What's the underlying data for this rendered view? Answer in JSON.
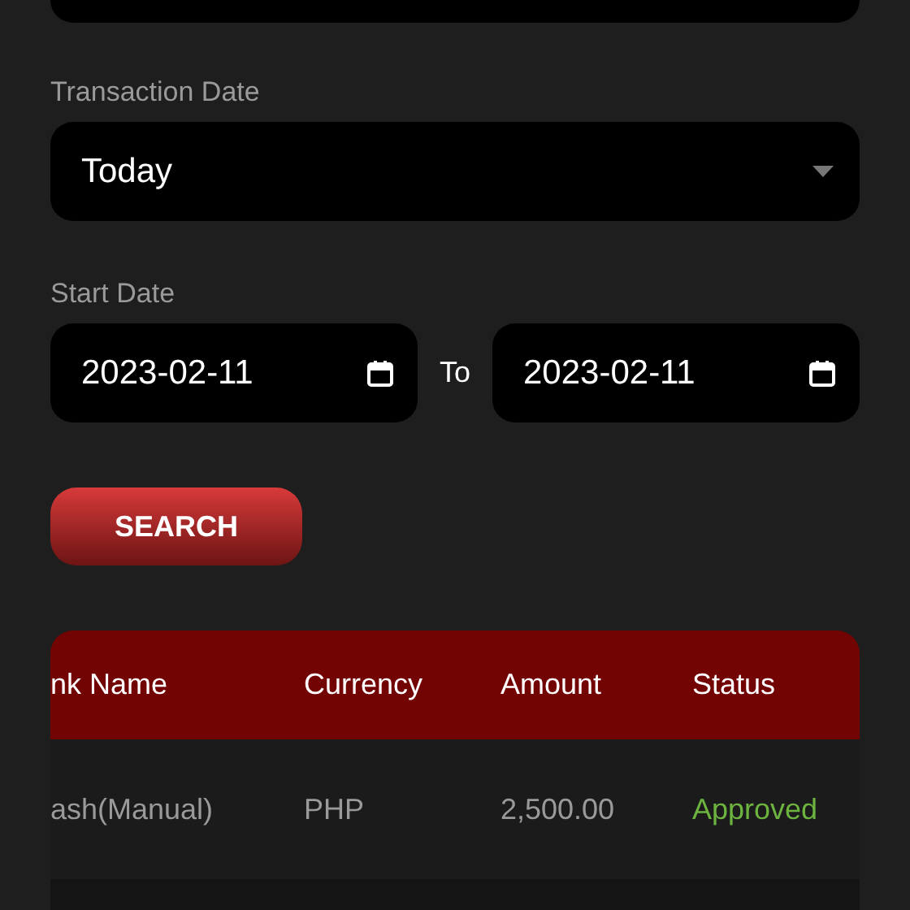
{
  "transaction_date": {
    "label": "Transaction Date",
    "value": "Today"
  },
  "date_range": {
    "label": "Start Date",
    "start": "2023-02-11",
    "separator": "To",
    "end": "2023-02-11"
  },
  "search_button": {
    "label": "SEARCH"
  },
  "table": {
    "columns": [
      "nk Name",
      "Currency",
      "Amount",
      "Status"
    ],
    "rows": [
      {
        "cells": [
          {
            "kind": "text",
            "text": "ash(Manual)"
          },
          {
            "kind": "text",
            "text": "PHP"
          },
          {
            "kind": "text",
            "text": "2,500.00"
          },
          {
            "kind": "status",
            "text": "Approved"
          }
        ]
      }
    ]
  }
}
